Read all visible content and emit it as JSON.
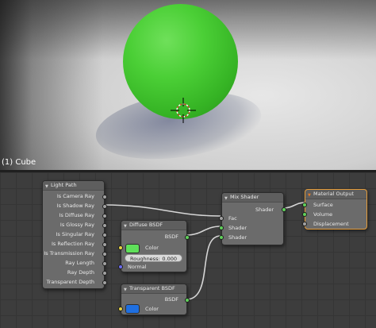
{
  "viewport": {
    "object_label": "(1) Cube"
  },
  "colors": {
    "sphere": "#4bcf36",
    "active_node_border": "#e39b3a",
    "diffuse_color": "#5fe05a",
    "transparent_color": "#1f6fe0"
  },
  "nodes": {
    "light_path": {
      "title": "Light Path",
      "outputs": [
        "Is Camera Ray",
        "Is Shadow Ray",
        "Is Diffuse Ray",
        "Is Glossy Ray",
        "Is Singular Ray",
        "Is Reflection Ray",
        "Is Transmission Ray",
        "Ray Length",
        "Ray Depth",
        "Transparent Depth"
      ]
    },
    "diffuse_bsdf": {
      "title": "Diffuse BSDF",
      "output": "BSDF",
      "color_label": "Color",
      "roughness_label": "Roughness:",
      "roughness_value": "0.000",
      "normal_label": "Normal"
    },
    "transparent_bsdf": {
      "title": "Transparent BSDF",
      "output": "BSDF",
      "color_label": "Color"
    },
    "mix_shader": {
      "title": "Mix Shader",
      "output": "Shader",
      "inputs": [
        "Fac",
        "Shader",
        "Shader"
      ]
    },
    "material_output": {
      "title": "Material Output",
      "inputs": [
        "Surface",
        "Volume",
        "Displacement"
      ]
    }
  }
}
